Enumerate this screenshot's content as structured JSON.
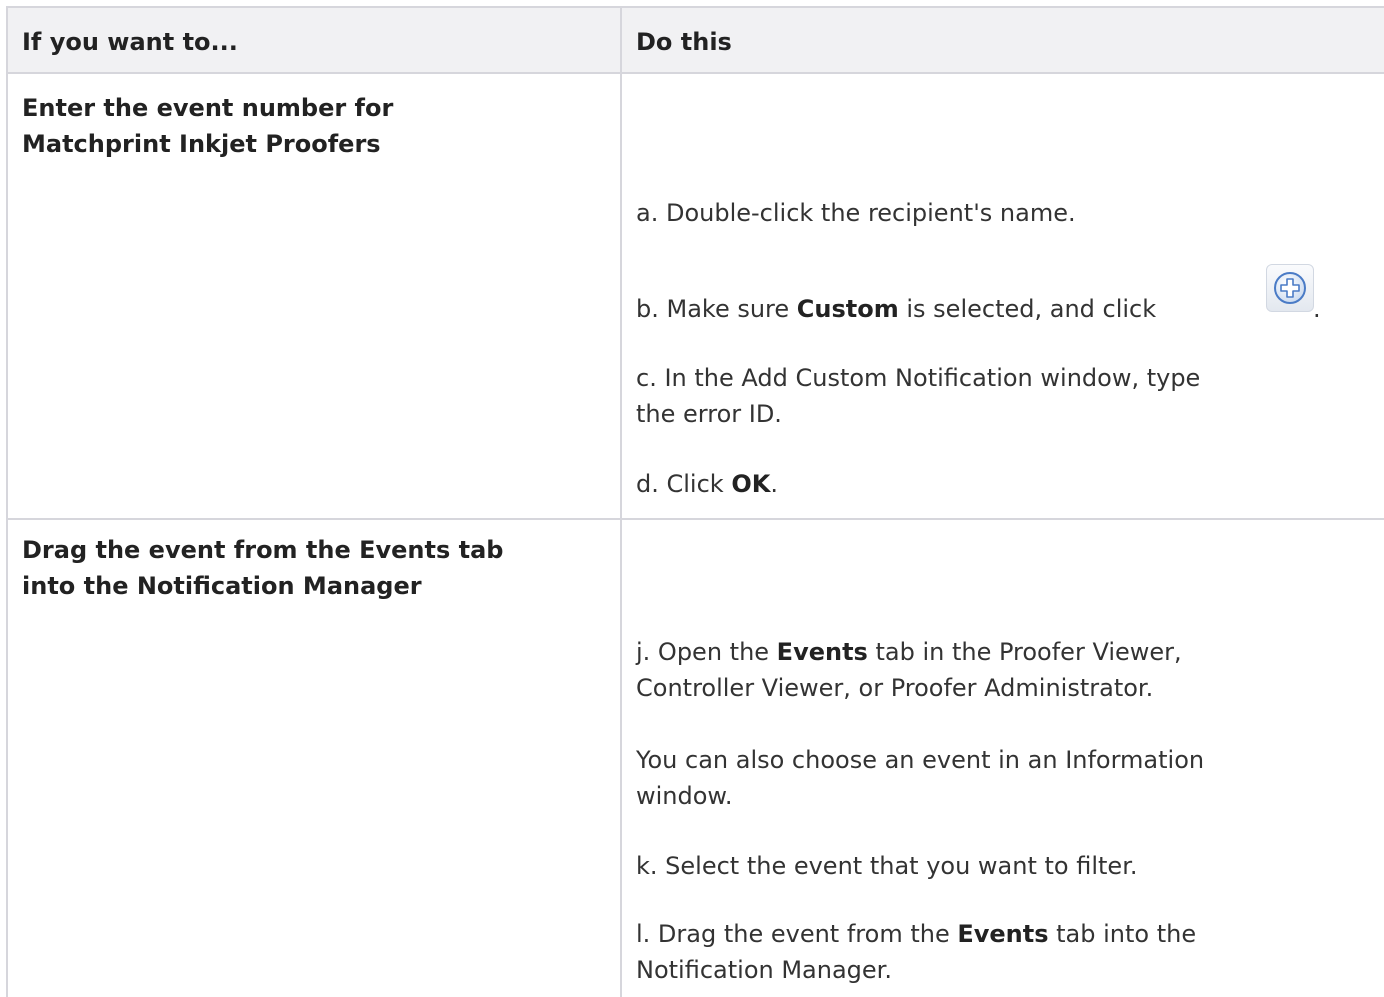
{
  "table": {
    "headers": [
      "If you want to...",
      "Do this"
    ],
    "rows": [
      {
        "action": [
          "Enter the event number for",
          "Matchprint Inkjet Proofers"
        ],
        "steps": {
          "a_prefix": "a.  Double-click the recipient's name.",
          "b_pre": "b.  Make sure ",
          "b_bold": "Custom",
          "b_post": " is selected, and click",
          "b_end": ".",
          "b_icon": "add-plus-icon",
          "c_line1": "c.  In the Add Custom Notification window, type",
          "c_line2": "the error ID.",
          "d_pre": "d.  Click ",
          "d_bold": "OK",
          "d_post": "."
        }
      },
      {
        "action": [
          "Drag the event from the Events tab",
          "into the Notification Manager"
        ],
        "steps": {
          "j_pre": "j.  Open the ",
          "j_bold": "Events",
          "j_post": " tab in the Proofer Viewer,",
          "j_line2": "Controller Viewer, or Proofer Administrator.",
          "note_line1": "You can also choose an event in an Information",
          "note_line2": "window.",
          "k": "k.  Select the event that you want to filter.",
          "l_pre": "l.  Drag the event from the ",
          "l_bold": "Events",
          "l_post": " tab into the",
          "l_line2": "Notification Manager."
        }
      }
    ]
  },
  "colors": {
    "border": "#d6d6dc",
    "header_bg": "#f1f1f3",
    "text": "#333333",
    "icon_accent": "#4a7bc6"
  }
}
